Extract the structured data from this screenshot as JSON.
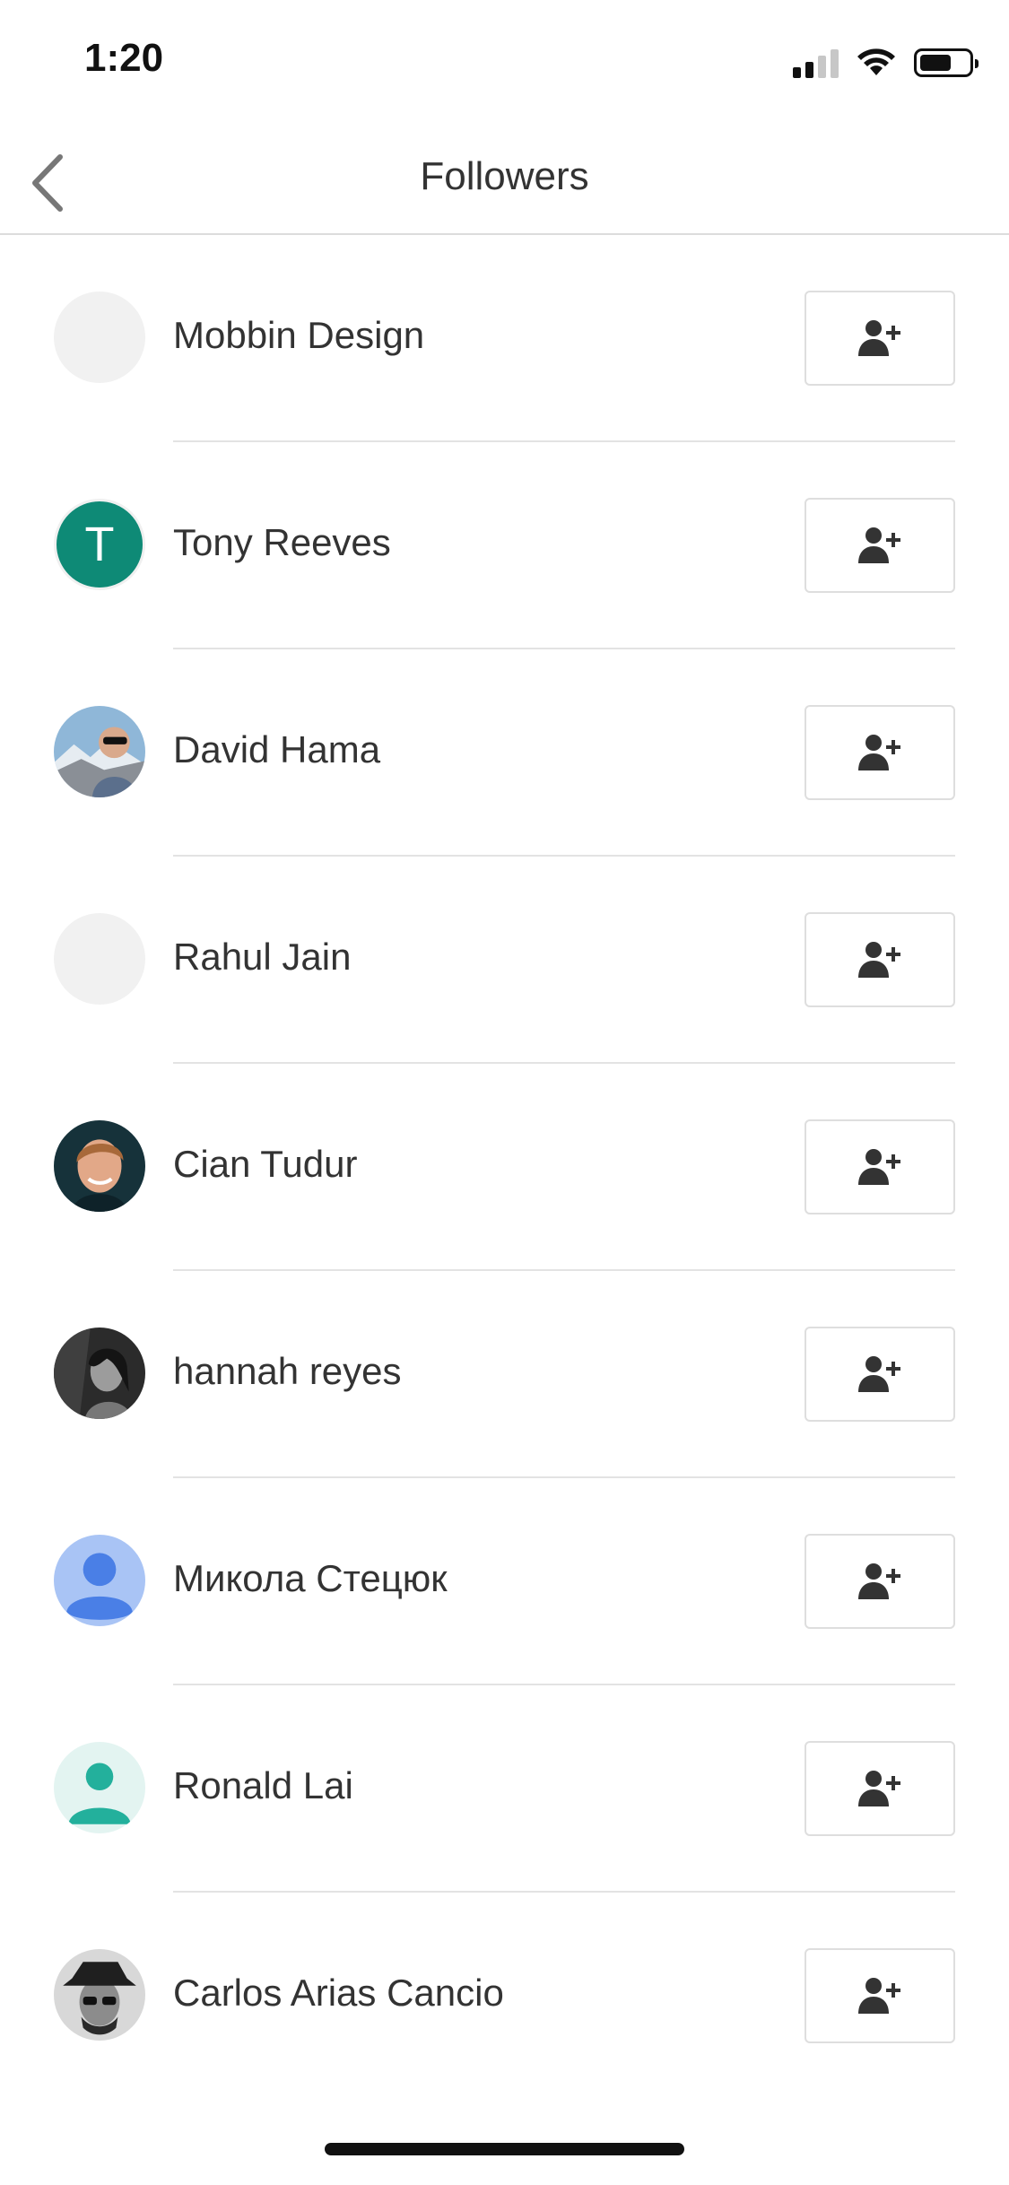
{
  "status_bar": {
    "time": "1:20",
    "icons": [
      "cellular-signal-icon",
      "wifi-icon",
      "battery-icon"
    ]
  },
  "header": {
    "title": "Followers",
    "back_icon": "chevron-left-icon"
  },
  "followers": [
    {
      "name": "Mobbin Design",
      "avatar": "placeholder"
    },
    {
      "name": "Tony Reeves",
      "avatar": "letter",
      "initial": "T",
      "avatar_color": "#0e8a76"
    },
    {
      "name": "David Hama",
      "avatar": "photo"
    },
    {
      "name": "Rahul Jain",
      "avatar": "placeholder"
    },
    {
      "name": "Cian Tudur",
      "avatar": "photo"
    },
    {
      "name": "hannah reyes",
      "avatar": "photo"
    },
    {
      "name": "Микола Стецюк",
      "avatar": "default-person-blue"
    },
    {
      "name": "Ronald Lai",
      "avatar": "default-person-teal"
    },
    {
      "name": "Carlos Arias Cancio",
      "avatar": "photo"
    }
  ],
  "follow_button_icon": "add-person-icon",
  "colors": {
    "text": "#333333",
    "divider": "#e3e3e3",
    "button_border": "#dedede",
    "tony_avatar": "#0e8a76"
  }
}
